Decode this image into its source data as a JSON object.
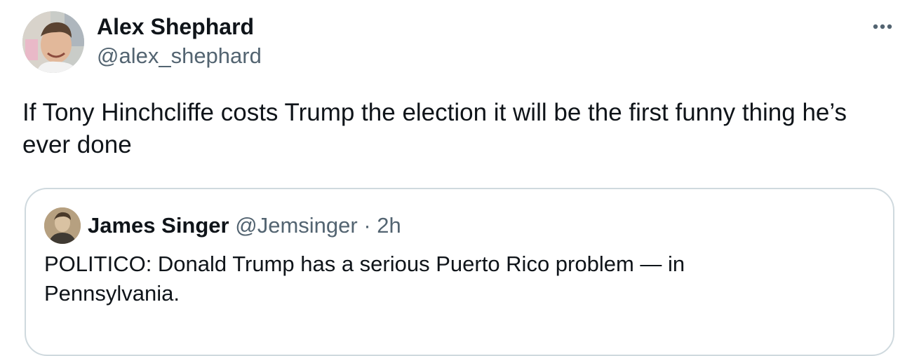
{
  "tweet": {
    "author": {
      "name": "Alex Shephard",
      "handle": "@alex_shephard"
    },
    "text": "If Tony Hinchcliffe costs Trump the election it will be the first funny thing he’s ever done",
    "menu_icon": "more-horizontal-icon"
  },
  "quote": {
    "author": {
      "name": "James Singer",
      "handle": "@Jemsinger",
      "separator": "·",
      "time": "2h"
    },
    "text": "POLITICO: Donald Trump has a serious Puerto Rico problem — in Pennsylvania."
  },
  "colors": {
    "text_primary": "#0f1419",
    "text_secondary": "#536471",
    "border": "#cfd9de",
    "background": "#ffffff"
  }
}
